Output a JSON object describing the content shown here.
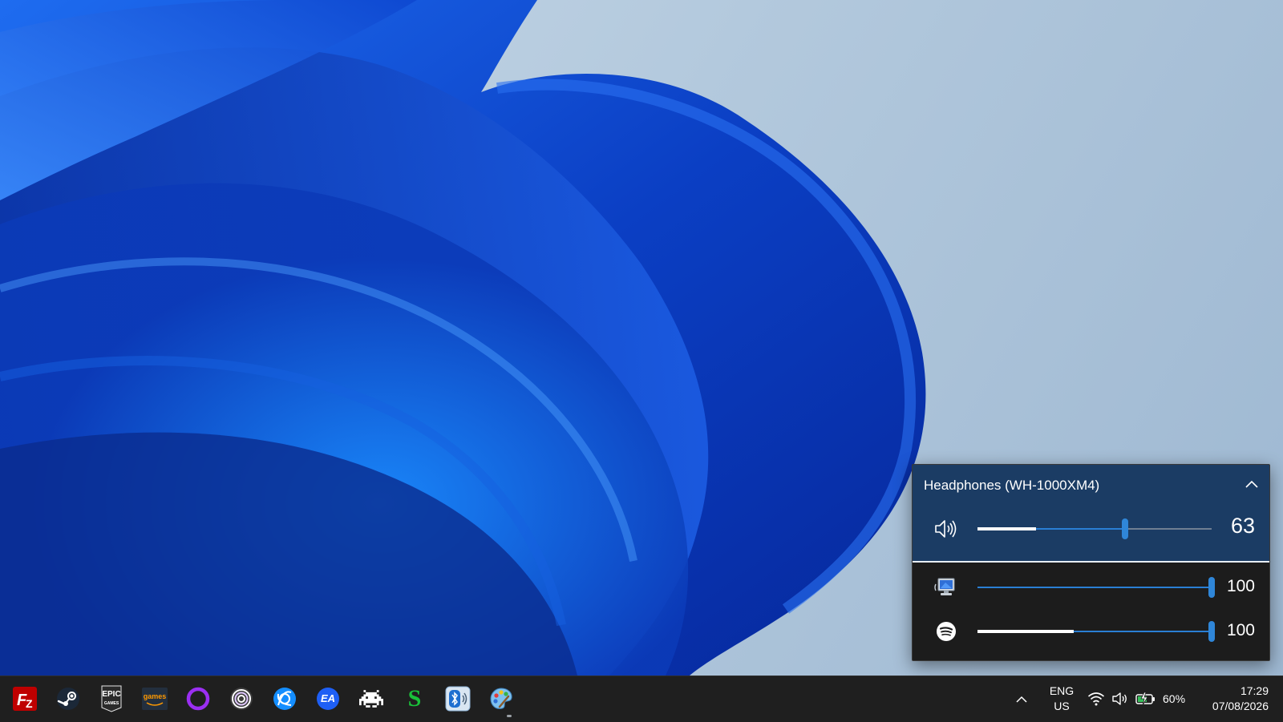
{
  "volume_flyout": {
    "device_name": "Headphones (WH-1000XM4)",
    "device": {
      "icon": "speaker-icon",
      "level": 63,
      "peak_fraction": 0.25
    },
    "apps": [
      {
        "app": "system-sounds",
        "icon": "system-sounds-icon",
        "level": 100,
        "peak_fraction": 0.0,
        "value_label": "100"
      },
      {
        "app": "spotify",
        "icon": "spotify-icon",
        "level": 100,
        "peak_fraction": 0.41,
        "value_label": "100"
      }
    ],
    "device_value_label": "63",
    "accent_color": "#2f86d8",
    "panel_color": "#1b3c64"
  },
  "taskbar": {
    "pinned_apps": [
      {
        "name": "FileZilla",
        "icon": "filezilla-icon"
      },
      {
        "name": "Steam",
        "icon": "steam-icon"
      },
      {
        "name": "Epic Games",
        "icon": "epic-games-icon",
        "label_top": "EPIC",
        "label_bottom": "GAMES"
      },
      {
        "name": "Amazon Games",
        "icon": "amazon-games-icon",
        "label": "games"
      },
      {
        "name": "Circle app",
        "icon": "purple-circle-icon"
      },
      {
        "name": "GOG Galaxy",
        "icon": "gog-galaxy-icon"
      },
      {
        "name": "Battle.net",
        "icon": "battlenet-icon"
      },
      {
        "name": "EA",
        "icon": "ea-icon",
        "label": "EA"
      },
      {
        "name": "Space Invaders app",
        "icon": "invader-icon"
      },
      {
        "name": "S app",
        "icon": "s-app-icon",
        "label": "S"
      },
      {
        "name": "Bluetooth audio",
        "icon": "bluetooth-audio-icon"
      },
      {
        "name": "Paint",
        "icon": "paint-palette-icon",
        "active": true
      }
    ],
    "tray": {
      "language_top": "ENG",
      "language_bottom": "US",
      "battery_percent": "60%",
      "time": "17:29",
      "date": "07/08/2026"
    }
  }
}
